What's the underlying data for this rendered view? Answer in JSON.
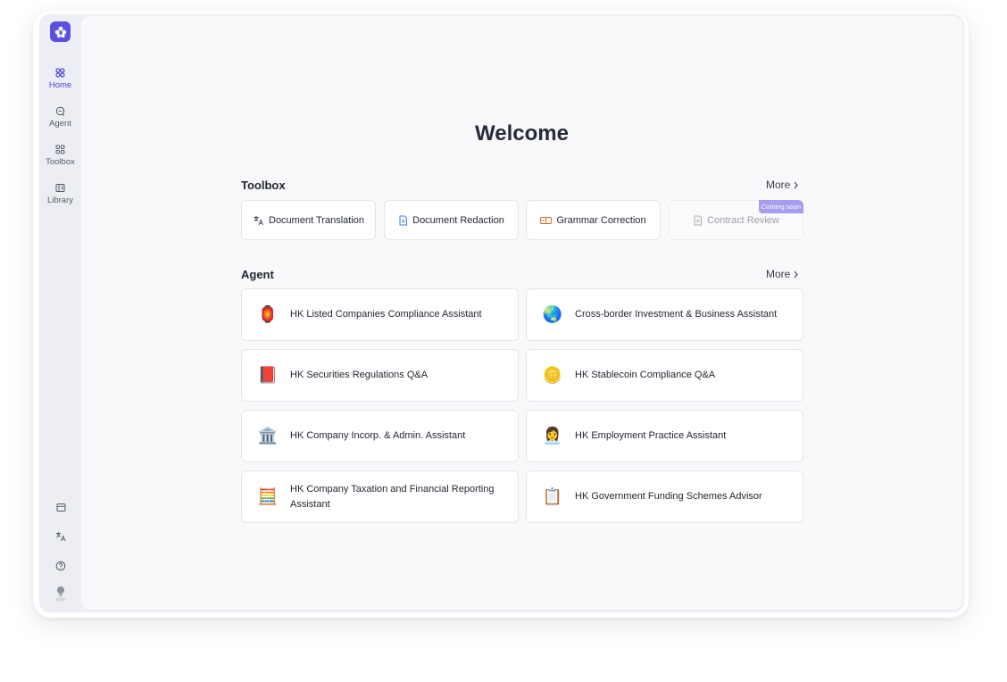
{
  "sidebar": {
    "nav": [
      {
        "label": "Home",
        "icon": "home-grid-icon",
        "active": true
      },
      {
        "label": "Agent",
        "icon": "chat-bubble-icon",
        "active": false
      },
      {
        "label": "Toolbox",
        "icon": "toolbox-icon",
        "active": false
      },
      {
        "label": "Library",
        "icon": "library-icon",
        "active": false
      }
    ],
    "bottom_icons": [
      "panel-icon",
      "translate-icon",
      "help-icon",
      "user-avatar"
    ]
  },
  "main": {
    "title": "Welcome",
    "toolbox": {
      "title": "Toolbox",
      "more": "More",
      "tools": [
        {
          "label": "Document Translation",
          "icon": "translate-icon",
          "disabled": false
        },
        {
          "label": "Document Redaction",
          "icon": "document-icon",
          "disabled": false
        },
        {
          "label": "Grammar Correction",
          "icon": "grammar-icon",
          "disabled": false
        },
        {
          "label": "Contract Review",
          "icon": "contract-icon",
          "disabled": true,
          "badge": "Coming soon"
        }
      ]
    },
    "agent": {
      "title": "Agent",
      "more": "More",
      "agents": [
        {
          "label": "HK Listed Companies Compliance Assistant",
          "icon": "🏮"
        },
        {
          "label": "Cross-border Investment & Business Assistant",
          "icon": "🌏"
        },
        {
          "label": "HK Securities Regulations Q&A",
          "icon": "📕"
        },
        {
          "label": "HK Stablecoin Compliance Q&A",
          "icon": "🪙"
        },
        {
          "label": "HK Company Incorp. & Admin. Assistant",
          "icon": "🏛️"
        },
        {
          "label": "HK Employment Practice Assistant",
          "icon": "👩‍💼"
        },
        {
          "label": "HK Company Taxation and Financial Reporting Assistant",
          "icon": "🧮"
        },
        {
          "label": "HK Government Funding Schemes Advisor",
          "icon": "📋"
        }
      ]
    }
  },
  "colors": {
    "accent": "#4b44d8",
    "logo": "#5b4fe0",
    "badge": "#a79df0"
  }
}
